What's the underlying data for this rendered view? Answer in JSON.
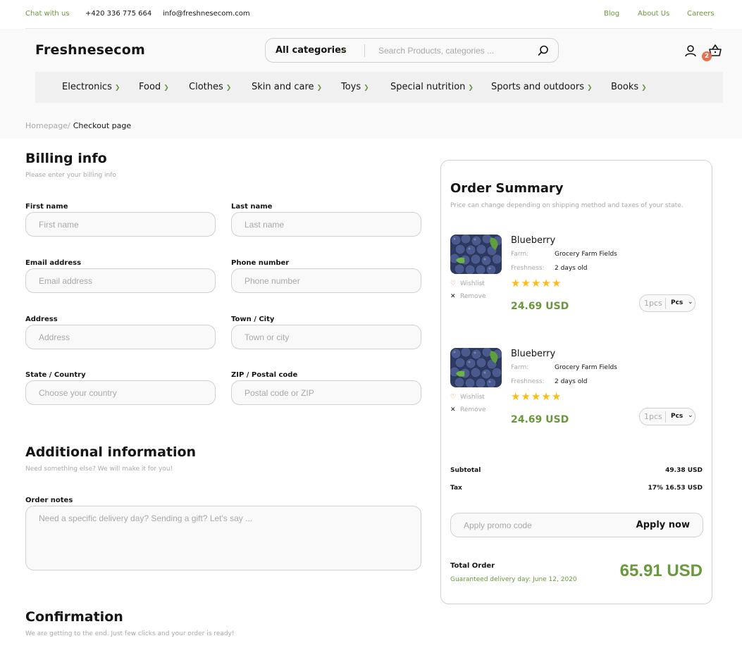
{
  "topbar": {
    "chat": "Chat with us",
    "phone": "+420 336 775 664",
    "email": "info@freshnesecom.com",
    "links": [
      "Blog",
      "About Us",
      "Careers"
    ]
  },
  "header": {
    "logo": "Freshnesecom",
    "category_select": "All categories",
    "search_placeholder": "Search Products, categories ...",
    "cart_count": "2"
  },
  "categories": [
    "Electronics",
    "Food",
    "Clothes",
    "Skin and care",
    "Toys",
    "Special nutrition",
    "Sports and outdoors",
    "Books"
  ],
  "breadcrumb": {
    "parent": "Homepage",
    "separator": "/",
    "current": "Checkout page"
  },
  "billing": {
    "title": "Billing info",
    "subtitle": "Please enter your billing info",
    "fields": {
      "first_name": {
        "label": "First name",
        "placeholder": "First name"
      },
      "last_name": {
        "label": "Last name",
        "placeholder": "Last name"
      },
      "email": {
        "label": "Email address",
        "placeholder": "Email address"
      },
      "phone": {
        "label": "Phone number",
        "placeholder": "Phone number"
      },
      "address": {
        "label": "Address",
        "placeholder": "Address"
      },
      "city": {
        "label": "Town / City",
        "placeholder": "Town or city"
      },
      "country": {
        "label": "State / Country",
        "placeholder": "Choose your country"
      },
      "zip": {
        "label": "ZIP / Postal code",
        "placeholder": "Postal code or ZIP"
      }
    }
  },
  "additional": {
    "title": "Additional information",
    "subtitle": "Need something else? We will make it for you!",
    "notes_label": "Order notes",
    "notes_placeholder": "Need a specific delivery day? Sending a gift? Let's say ..."
  },
  "confirmation": {
    "title": "Confirmation",
    "subtitle": "We are getting to the end. Just few clicks and your order is ready!"
  },
  "summary": {
    "title": "Order Summary",
    "note": "Price can change depending on shipping method and taxes of your state.",
    "items": [
      {
        "name": "Blueberry",
        "farm_label": "Farm:",
        "farm": "Grocery Farm Fields",
        "freshness_label": "Freshness:",
        "freshness": "2 days old",
        "rating": 5,
        "wishlist": "Wishlist",
        "remove": "Remove",
        "price": "24.69 USD",
        "qty": "1pcs",
        "unit": "Pcs"
      },
      {
        "name": "Blueberry",
        "farm_label": "Farm:",
        "farm": "Grocery Farm Fields",
        "freshness_label": "Freshness:",
        "freshness": "2 days old",
        "rating": 5,
        "wishlist": "Wishlist",
        "remove": "Remove",
        "price": "24.69 USD",
        "qty": "1pcs",
        "unit": "Pcs"
      }
    ],
    "subtotal_label": "Subtotal",
    "subtotal": "49.38 USD",
    "tax_label": "Tax",
    "tax": "17% 16.53 USD",
    "promo_placeholder": "Apply promo code",
    "promo_button": "Apply now",
    "total_label": "Total Order",
    "delivery": "Guaranteed delivery day: June 12, 2020",
    "total": "65.91 USD"
  },
  "colors": {
    "accent": "#6a983c",
    "badge": "#e5704b",
    "star": "#fdbc15",
    "muted": "#a9a9a9"
  }
}
